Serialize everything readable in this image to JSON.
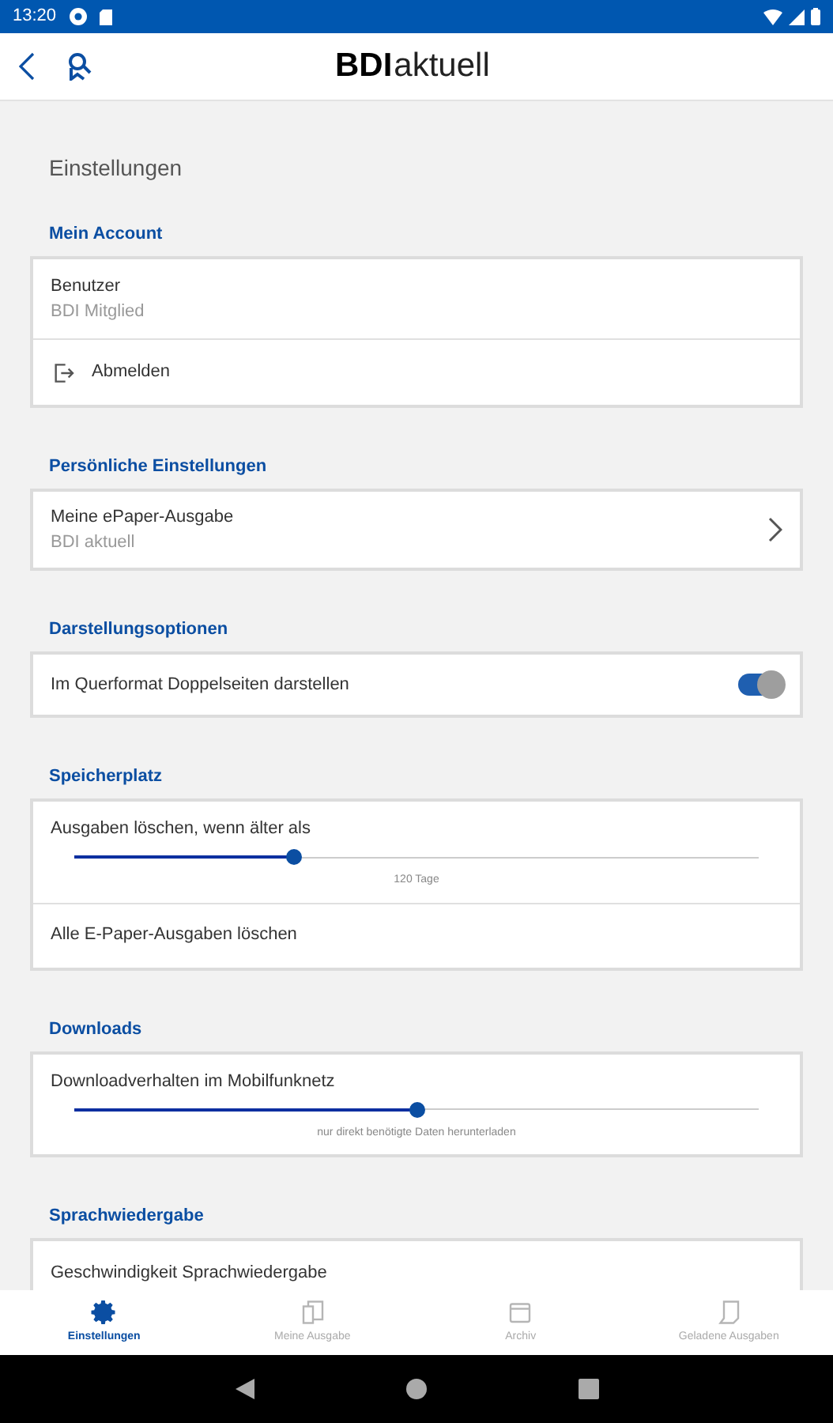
{
  "status_bar": {
    "time": "13:20"
  },
  "header": {
    "logo_bold": "BDI",
    "logo_light": "aktuell"
  },
  "page_title": "Einstellungen",
  "sections": [
    {
      "title": "Mein Account",
      "rows": [
        {
          "kind": "info",
          "label": "Benutzer",
          "value": "BDI Mitglied"
        },
        {
          "kind": "action",
          "label": "Abmelden"
        }
      ]
    },
    {
      "title": "Persönliche Einstellungen",
      "rows": [
        {
          "kind": "link",
          "label": "Meine ePaper-Ausgabe",
          "value": "BDI aktuell"
        }
      ]
    },
    {
      "title": "Darstellungsoptionen",
      "rows": [
        {
          "kind": "toggle",
          "label": "Im Querformat Doppelseiten darstellen",
          "on": true
        }
      ]
    },
    {
      "title": "Speicherplatz",
      "rows": [
        {
          "kind": "slider",
          "label": "Ausgaben löschen, wenn älter als",
          "level": 0.32,
          "reading": "120 Tage"
        },
        {
          "kind": "plain",
          "label": "Alle E-Paper-Ausgaben löschen"
        }
      ]
    },
    {
      "title": "Downloads",
      "rows": [
        {
          "kind": "slider",
          "label": "Downloadverhalten im Mobilfunknetz",
          "level": 0.5,
          "reading": "nur direkt benötigte Daten herunterladen"
        }
      ]
    },
    {
      "title": "Sprachwiedergabe",
      "rows": [
        {
          "kind": "plain",
          "label": "Geschwindigkeit Sprachwiedergabe"
        }
      ]
    }
  ],
  "bottom_nav": [
    {
      "label": "Einstellungen",
      "selected": true,
      "kind": "gear"
    },
    {
      "label": "Meine Ausgabe",
      "selected": false,
      "kind": "issue"
    },
    {
      "label": "Archiv",
      "selected": false,
      "kind": "archive"
    },
    {
      "label": "Geladene Ausgaben",
      "selected": false,
      "kind": "download"
    }
  ]
}
